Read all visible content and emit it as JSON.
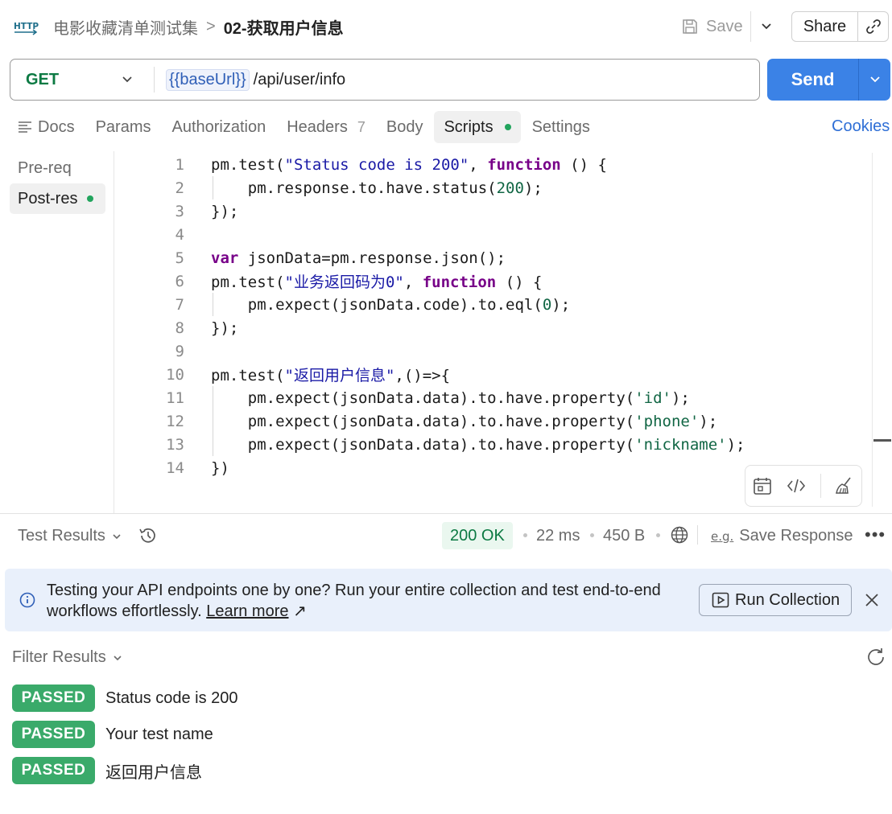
{
  "header": {
    "logo_text": "HTTP",
    "collection_name": "电影收藏清单测试集",
    "separator": ">",
    "request_name": "02-获取用户信息",
    "save_label": "Save",
    "share_label": "Share"
  },
  "request": {
    "method": "GET",
    "url_variable": "{{baseUrl}}",
    "url_path": "/api/user/info",
    "send_label": "Send"
  },
  "tabs": {
    "docs": "Docs",
    "params": "Params",
    "authorization": "Authorization",
    "headers": "Headers",
    "headers_count": "7",
    "body": "Body",
    "scripts": "Scripts",
    "settings": "Settings",
    "cookies": "Cookies"
  },
  "scripts": {
    "pre_request": "Pre-req",
    "post_response": "Post-res",
    "lines": [
      {
        "n": "1"
      },
      {
        "n": "2"
      },
      {
        "n": "3"
      },
      {
        "n": "4"
      },
      {
        "n": "5"
      },
      {
        "n": "6"
      },
      {
        "n": "7"
      },
      {
        "n": "8"
      },
      {
        "n": "9"
      },
      {
        "n": "10"
      },
      {
        "n": "11"
      },
      {
        "n": "12"
      },
      {
        "n": "13"
      },
      {
        "n": "14"
      }
    ],
    "code": {
      "l1_a": "pm.test(",
      "l1_str": "\"Status code is 200\"",
      "l1_b": ", ",
      "l1_kw": "function",
      "l1_c": " () {",
      "l2_a": "    pm.response.to.have.status(",
      "l2_num": "200",
      "l2_b": ");",
      "l3": "});",
      "l5_kw": "var",
      "l5_a": " jsonData=pm.response.json();",
      "l6_a": "pm.test(",
      "l6_str": "\"业务返回码为0\"",
      "l6_b": ", ",
      "l6_kw": "function",
      "l6_c": " () {",
      "l7_a": "    pm.expect(jsonData.code).to.eql(",
      "l7_num": "0",
      "l7_b": ");",
      "l8": "});",
      "l10_a": "pm.test(",
      "l10_str": "\"返回用户信息\"",
      "l10_b": ",()=>{",
      "l11_a": "    pm.expect(jsonData.data).to.have.property(",
      "l11_str": "'id'",
      "l11_b": ");",
      "l12_a": "    pm.expect(jsonData.data).to.have.property(",
      "l12_str": "'phone'",
      "l12_b": ");",
      "l13_a": "    pm.expect(jsonData.data).to.have.property(",
      "l13_str": "'nickname'",
      "l13_b": ");",
      "l14": "})"
    }
  },
  "response": {
    "test_results_label": "Test Results",
    "status": "200 OK",
    "time": "22 ms",
    "size": "450 B",
    "save_response_label": "Save Response",
    "save_response_icon_text": "e.g.",
    "more_label": "•••"
  },
  "banner": {
    "text": "Testing your API endpoints one by one? Run your entire collection and test end-to-end workflows effortlessly.",
    "learn_more": "Learn more",
    "learn_more_arrow": "↗",
    "run_collection_label": "Run Collection"
  },
  "results": {
    "filter_label": "Filter Results",
    "items": [
      {
        "status": "PASSED",
        "name": "Status code is 200"
      },
      {
        "status": "PASSED",
        "name": "Your test name"
      },
      {
        "status": "PASSED",
        "name": "返回用户信息"
      }
    ]
  },
  "colors": {
    "send": "#3b82e6",
    "method_get": "#0c7a43",
    "passed": "#3aaa6a",
    "status_ok_bg": "#eaf7ef",
    "banner_bg": "#e9f0fb",
    "link": "#2f6fd6"
  }
}
